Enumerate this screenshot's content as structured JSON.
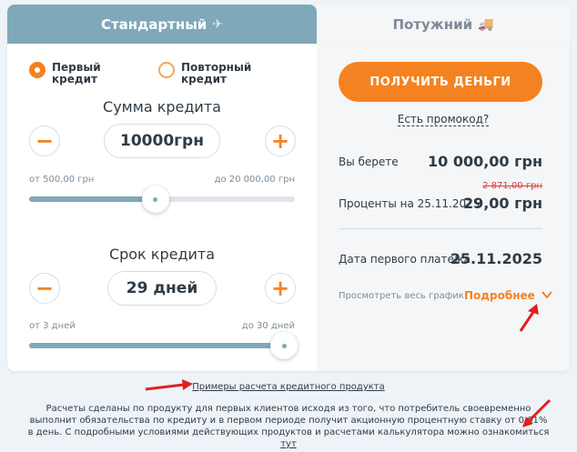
{
  "tabs": [
    {
      "label": "Стандартный",
      "icon": "plane-icon",
      "active": true
    },
    {
      "label": "Потужний",
      "icon": "truck-icon",
      "active": false
    }
  ],
  "radios": {
    "first": {
      "label_line1": "Первый",
      "label_line2": "кредит",
      "checked": true
    },
    "repeat": {
      "label_line1": "Повторный",
      "label_line2": "кредит",
      "checked": false
    }
  },
  "amount": {
    "title": "Сумма кредита",
    "value": "10000грн",
    "min_label": "от 500,00 грн",
    "max_label": "до 20 000,00 грн",
    "level_percent": 47.5,
    "minus": "−",
    "plus": "+"
  },
  "term": {
    "title": "Срок кредита",
    "value": "29 дней",
    "min_label": "от 3 дней",
    "max_label": "до 30 дней",
    "level_percent": 96,
    "minus": "−",
    "plus": "+"
  },
  "summary": {
    "button": "ПОЛУЧИТЬ ДЕНЬГИ",
    "promo": "Есть промокод?",
    "take_label": "Вы берете",
    "take_value": "10 000,00 грн",
    "old_interest": "2 871,00 грн",
    "interest_label": "Проценты на 25.11.2025",
    "interest_value": "29,00 грн",
    "first_payment_label": "Дата первого платежа",
    "first_payment_value": "25.11.2025",
    "schedule_label": "Просмотреть весь график",
    "more_label": "Подробнее"
  },
  "footer": {
    "examples_link": "Примеры расчета кредитного продукта",
    "text": "Расчеты сделаны по продукту для первых клиентов исходя из того, что потребитель своевременно выполнит обязательства по кредиту и в первом периоде получит акционную процентную ставку от 0,01% в день. С подробными условиями действующих продуктов и расчетами калькулятора можно ознакомиться",
    "here_link": "тут"
  },
  "colors": {
    "accent": "#f58220",
    "tab_active": "#7fa9b9",
    "annotation": "#e02020"
  }
}
